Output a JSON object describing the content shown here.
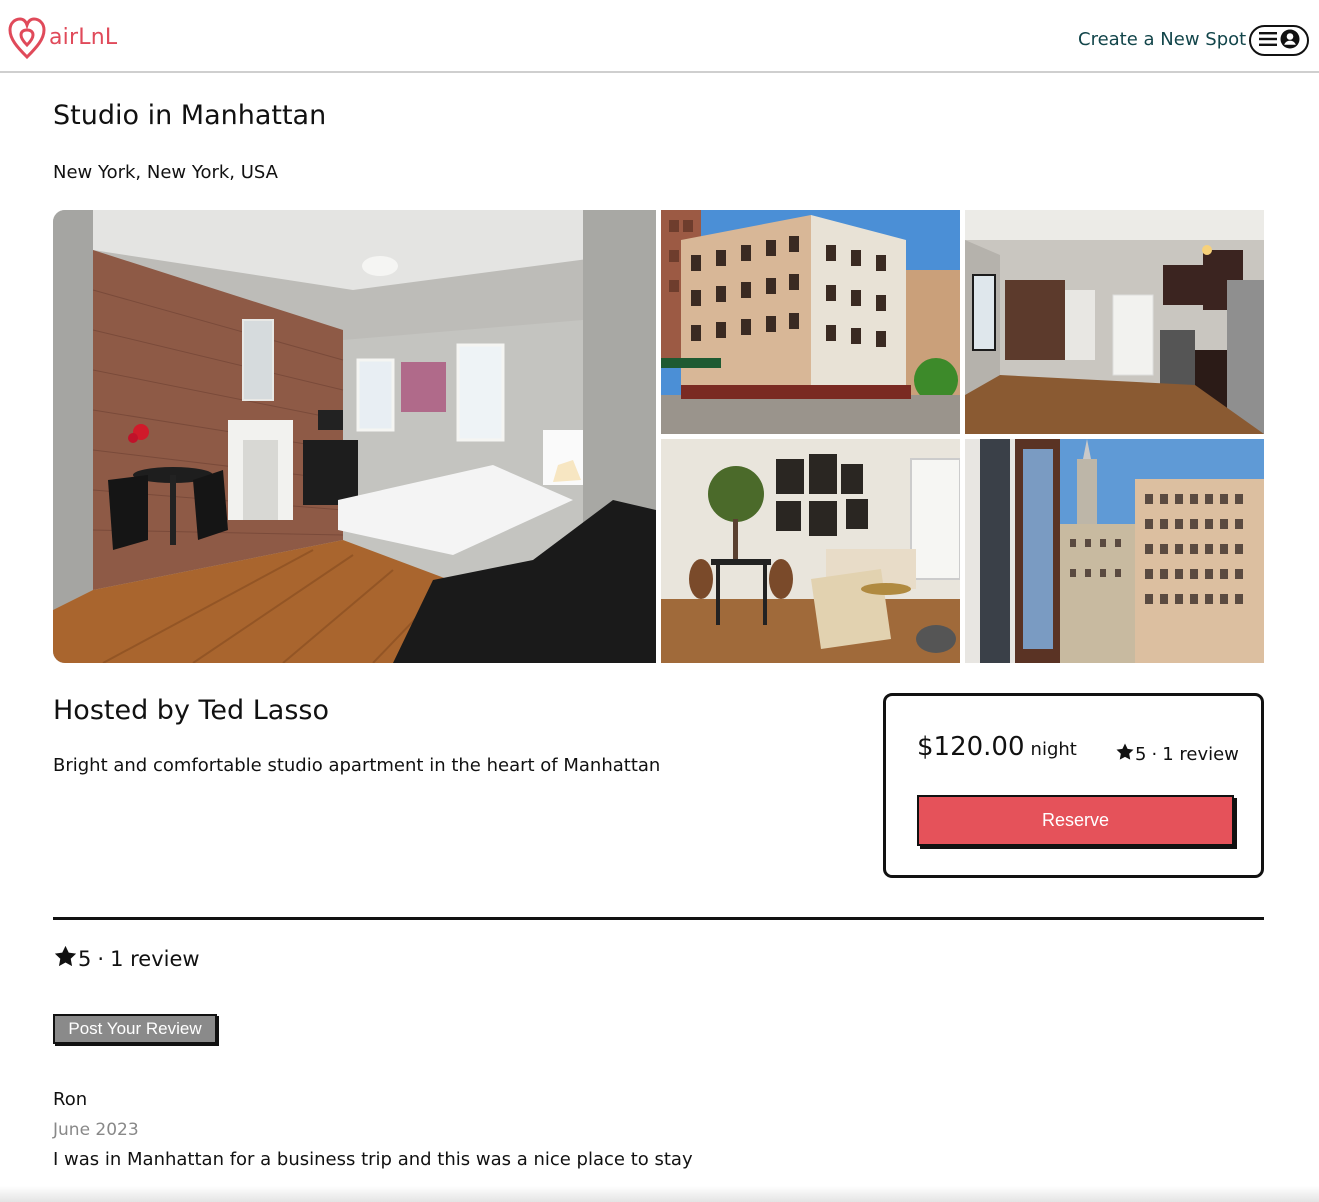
{
  "header": {
    "logo_text": "airLnL",
    "create_spot_label": "Create a New Spot",
    "brand_color": "#e04a5a"
  },
  "spot": {
    "title": "Studio in Manhattan",
    "location": "New York, New York, USA",
    "host_line": "Hosted by Ted Lasso",
    "description": "Bright and comfortable studio apartment in the heart of Manhattan"
  },
  "booking": {
    "price": "$120.00",
    "per_night": "night",
    "rating": "5",
    "separator": "·",
    "review_count": "1 review",
    "reserve_label": "Reserve",
    "reserve_color": "#e5525a"
  },
  "reviews": {
    "rating": "5",
    "separator": "·",
    "count_label": "1 review",
    "post_label": "Post Your Review",
    "items": [
      {
        "author": "Ron",
        "date": "June 2023",
        "text": "I was in Manhattan for a business trip and this was a nice place to stay"
      }
    ]
  },
  "icons": {
    "logo": "airbnb-style-heart-icon",
    "menu": "hamburger-menu-icon",
    "user": "user-circle-icon",
    "star": "star-icon"
  }
}
